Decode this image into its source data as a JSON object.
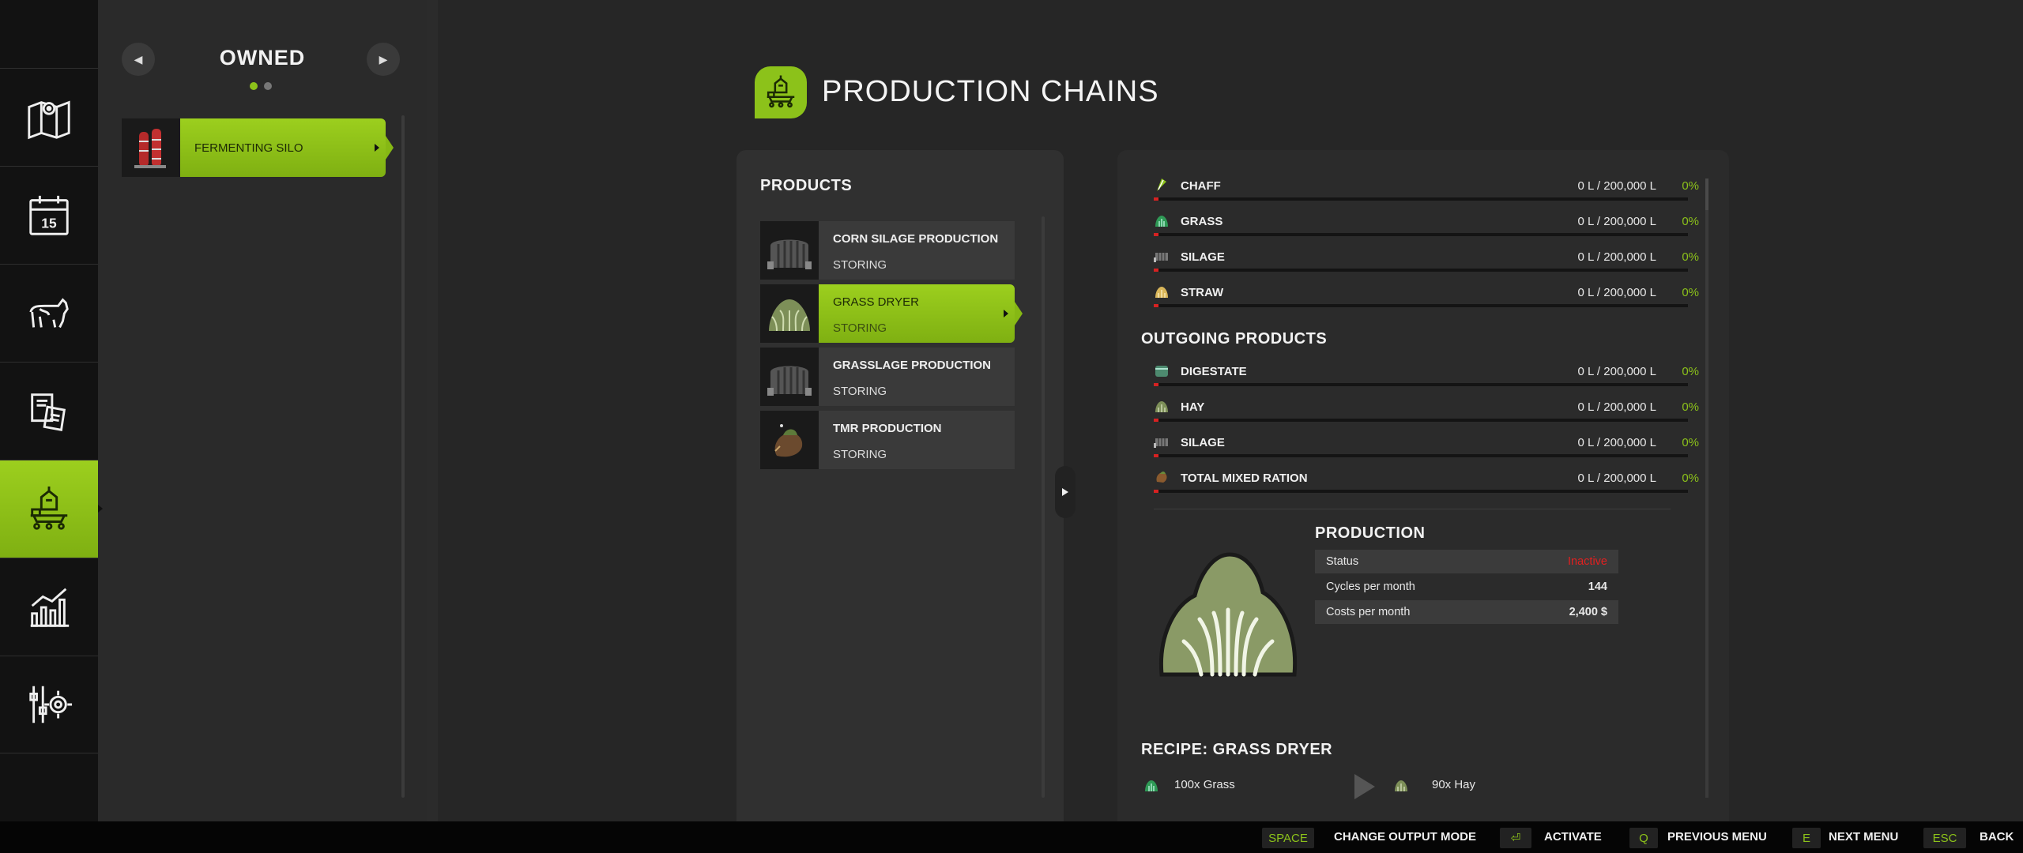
{
  "sidebar": {
    "owned_title": "OWNED",
    "pager_count": 2,
    "owned_items": [
      {
        "label": "FERMENTING SILO"
      }
    ],
    "rail_icons": [
      "map-icon",
      "calendar-icon",
      "animals-icon",
      "contracts-icon",
      "production-icon",
      "statistics-icon",
      "settings-icon"
    ],
    "calendar_day": "15"
  },
  "header": {
    "title": "PRODUCTION CHAINS"
  },
  "products": {
    "heading": "PRODUCTS",
    "items": [
      {
        "name": "CORN SILAGE PRODUCTION",
        "status": "STORING"
      },
      {
        "name": "GRASS DRYER",
        "status": "STORING",
        "selected": true
      },
      {
        "name": "GRASSLAGE PRODUCTION",
        "status": "STORING"
      },
      {
        "name": "TMR PRODUCTION",
        "status": "STORING"
      }
    ]
  },
  "details": {
    "incoming": [
      {
        "name": "CHAFF",
        "amount": "0 L / 200,000 L",
        "percent": "0%"
      },
      {
        "name": "GRASS",
        "amount": "0 L / 200,000 L",
        "percent": "0%"
      },
      {
        "name": "SILAGE",
        "amount": "0 L / 200,000 L",
        "percent": "0%"
      },
      {
        "name": "STRAW",
        "amount": "0 L / 200,000 L",
        "percent": "0%"
      }
    ],
    "outgoing_heading": "OUTGOING PRODUCTS",
    "outgoing": [
      {
        "name": "DIGESTATE",
        "amount": "0 L / 200,000 L",
        "percent": "0%"
      },
      {
        "name": "HAY",
        "amount": "0 L / 200,000 L",
        "percent": "0%"
      },
      {
        "name": "SILAGE",
        "amount": "0 L / 200,000 L",
        "percent": "0%"
      },
      {
        "name": "TOTAL MIXED RATION",
        "amount": "0 L / 200,000 L",
        "percent": "0%"
      }
    ],
    "production": {
      "heading": "PRODUCTION",
      "status_label": "Status",
      "status_value": "Inactive",
      "cycles_label": "Cycles per month",
      "cycles_value": "144",
      "costs_label": "Costs per month",
      "costs_value": "2,400 $"
    },
    "recipe": {
      "heading": "RECIPE: GRASS DRYER",
      "input": "100x Grass",
      "output": "90x Hay"
    }
  },
  "bottom_bar": [
    {
      "key": "SPACE",
      "label": "CHANGE OUTPUT MODE"
    },
    {
      "key": "⏎",
      "label": "ACTIVATE"
    },
    {
      "key": "Q",
      "label": "PREVIOUS MENU"
    },
    {
      "key": "E",
      "label": "NEXT MENU"
    },
    {
      "key": "ESC",
      "label": "BACK"
    }
  ],
  "colors": {
    "accent": "#8cc21a",
    "inactive": "#e02020",
    "fill_bar": "#d62222"
  }
}
